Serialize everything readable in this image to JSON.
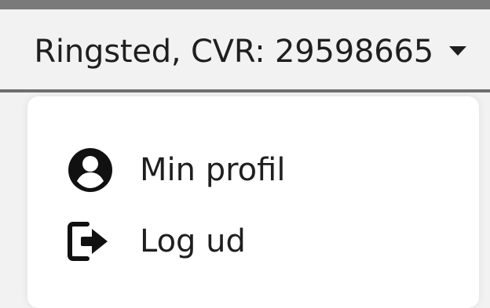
{
  "header": {
    "company_text": "Ringsted, CVR: 29598665",
    "caret_icon": "caret-down-icon"
  },
  "menu": {
    "items": [
      {
        "label": "Min profil",
        "icon": "user-circle-icon"
      },
      {
        "label": "Log ud",
        "icon": "sign-out-icon"
      }
    ]
  }
}
